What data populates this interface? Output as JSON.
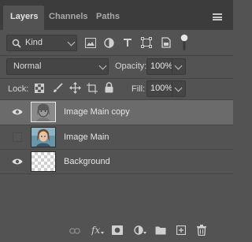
{
  "tabs": [
    {
      "label": "Layers",
      "active": true
    },
    {
      "label": "Channels",
      "active": false
    },
    {
      "label": "Paths",
      "active": false
    }
  ],
  "filter": {
    "kind_label": "Kind",
    "icons": [
      "pixel-filter-icon",
      "adjustment-filter-icon",
      "type-filter-icon",
      "shape-filter-icon",
      "smart-object-filter-icon",
      "filter-toggle-icon"
    ]
  },
  "blend": {
    "mode": "Normal",
    "opacity_label": "Opacity:",
    "opacity_value": "100%"
  },
  "lock": {
    "label": "Lock:",
    "fill_label": "Fill:",
    "fill_value": "100%",
    "icons": [
      "lock-transparent-icon",
      "lock-image-icon",
      "lock-position-icon",
      "lock-artboard-icon",
      "lock-all-icon"
    ]
  },
  "layers": [
    {
      "name": "Image Main copy",
      "visible": true,
      "selected": true,
      "thumb": "photo-highpass"
    },
    {
      "name": "Image Main",
      "visible": false,
      "selected": false,
      "thumb": "photo"
    },
    {
      "name": "Background",
      "visible": true,
      "selected": false,
      "thumb": "transparent"
    }
  ],
  "footer_icons": [
    "link-layers-icon",
    "layer-style-icon",
    "add-mask-icon",
    "adjustment-layer-icon",
    "new-group-icon",
    "new-layer-icon",
    "delete-layer-icon"
  ],
  "colors": {
    "panel": "#535353",
    "tabbar": "#3c3c3c",
    "selected_row": "#6b6b6b"
  }
}
